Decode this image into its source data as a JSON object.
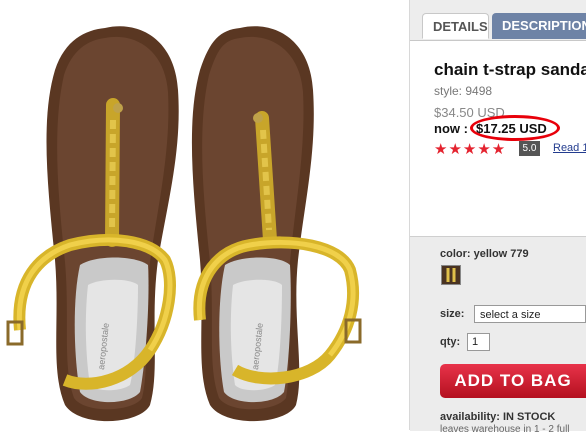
{
  "tabs": [
    {
      "label": "DETAILS"
    },
    {
      "label": "DESCRIPTION"
    }
  ],
  "product": {
    "title": "chain t-strap sandal",
    "style": "style: 9498",
    "original_price": "$34.50 USD",
    "now_label": "now :",
    "sale_price": "$17.25 USD",
    "stars": "★★★★★",
    "rating": "5.0",
    "read_reviews_link": "Read 1"
  },
  "image": {
    "brand_text": "aeropostale"
  },
  "options": {
    "color_label": "color: yellow 779",
    "size_label": "size:",
    "size_select_value": "select a size",
    "qty_label": "qty:",
    "qty_value": "1",
    "add_to_bag_label": "ADD TO BAG",
    "availability": "availability: IN STOCK",
    "shipping_note": "leaves warehouse in 1 - 2 full"
  },
  "colors": {
    "accent_red": "#e4232f",
    "tab_blue": "#6e83a6",
    "button_red": "#c81d30",
    "link_blue": "#233c8f"
  }
}
